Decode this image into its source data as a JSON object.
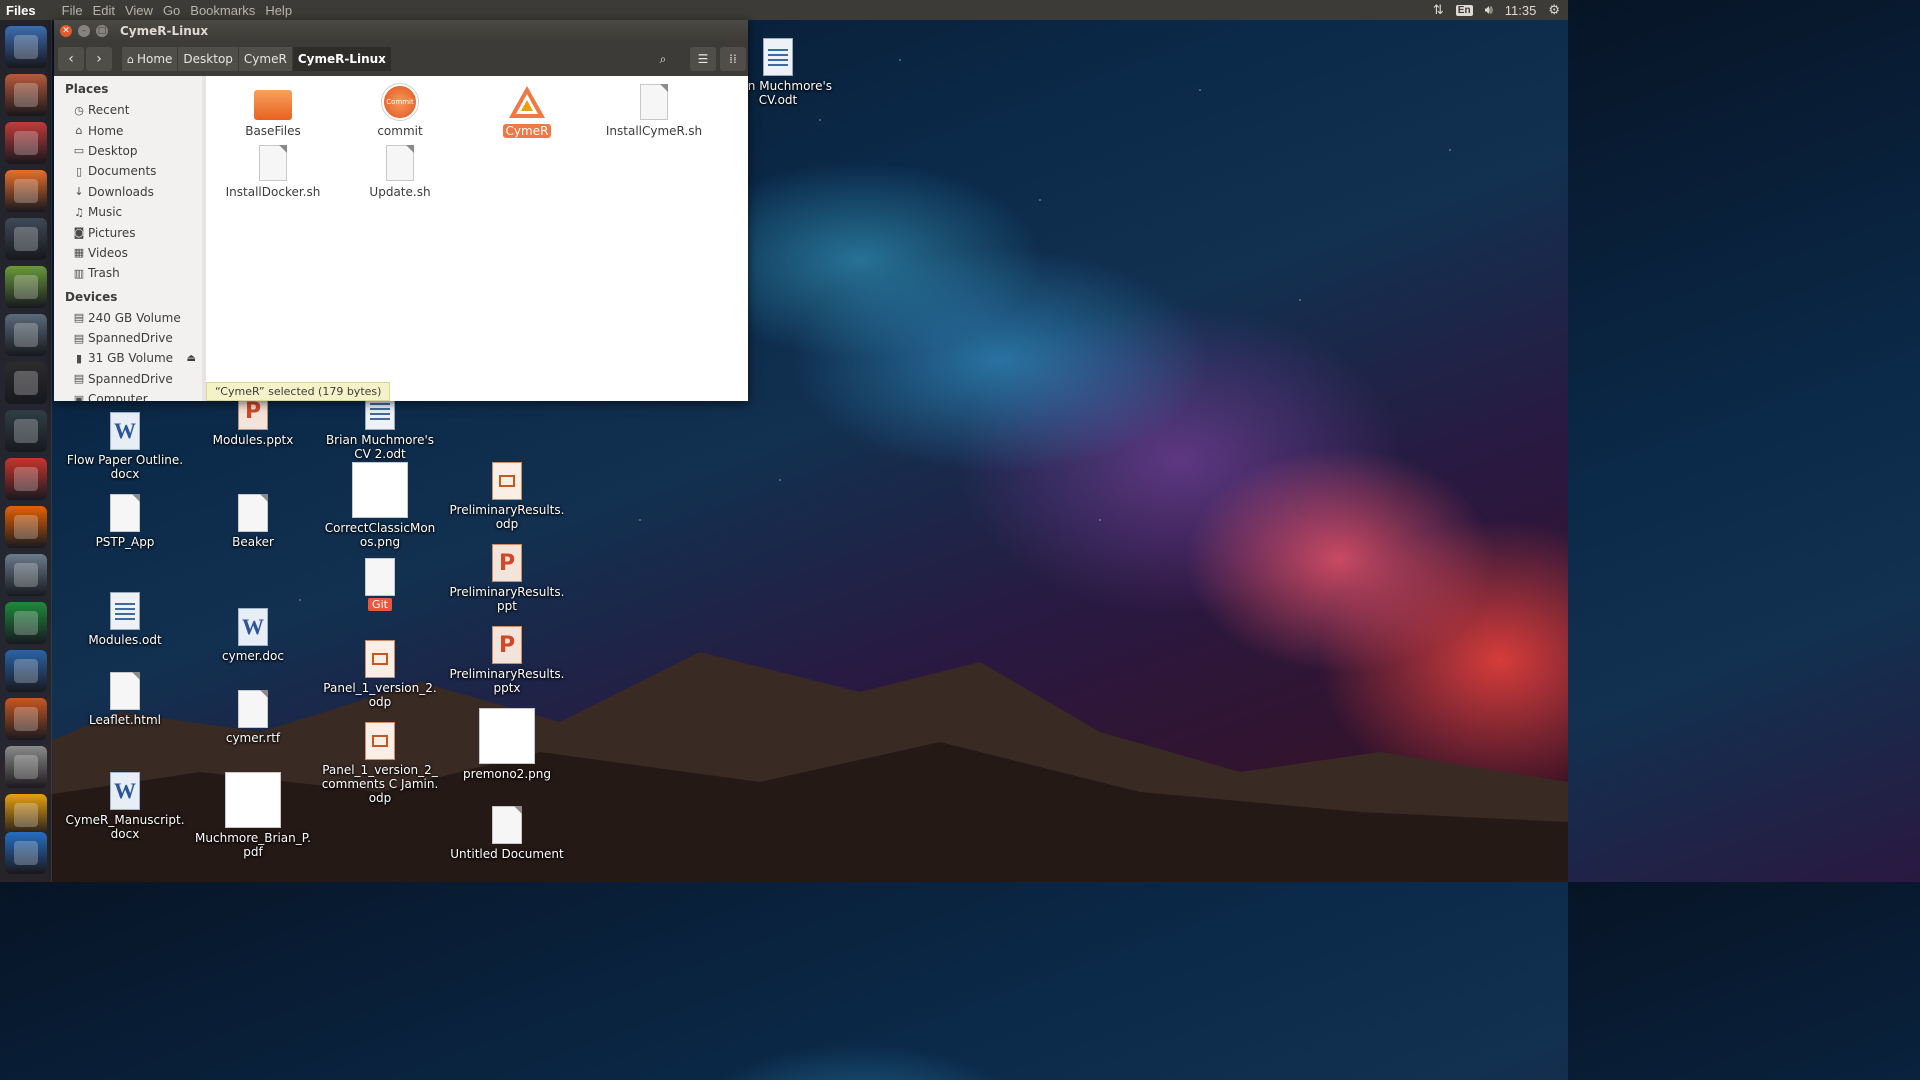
{
  "top_panel": {
    "app_name": "Files",
    "menu": [
      "File",
      "Edit",
      "View",
      "Go",
      "Bookmarks",
      "Help"
    ],
    "keyboard_layout": "En",
    "clock": "11:35"
  },
  "launcher": {
    "items": [
      {
        "name": "dash-icon",
        "color": "#3b6db0"
      },
      {
        "name": "files-icon",
        "color": "#b85a3a"
      },
      {
        "name": "system-settings-icon",
        "color": "#c23b3b"
      },
      {
        "name": "software-center-icon",
        "color": "#e8702a"
      },
      {
        "name": "game-icon",
        "color": "#3f4a57"
      },
      {
        "name": "disk-usage-icon",
        "color": "#6a9a3a"
      },
      {
        "name": "printer-icon",
        "color": "#5a6b7a"
      },
      {
        "name": "terminal-icon",
        "color": "#2c2c2c"
      },
      {
        "name": "system-monitor-icon",
        "color": "#2f3e46"
      },
      {
        "name": "pdf-reader-icon",
        "color": "#c8342c"
      },
      {
        "name": "firefox-icon",
        "color": "#e66000"
      },
      {
        "name": "image-viewer-icon",
        "color": "#6b7b8b"
      },
      {
        "name": "libreoffice-calc-icon",
        "color": "#1e8a3c"
      },
      {
        "name": "libreoffice-writer-icon",
        "color": "#2a63a8"
      },
      {
        "name": "libreoffice-impress-icon",
        "color": "#c8571f"
      },
      {
        "name": "text-editor-icon",
        "color": "#8a8a8a"
      },
      {
        "name": "cymer-app-icon",
        "color": "#e8a010"
      },
      {
        "name": "r-app-icon",
        "color": "#276dc3"
      }
    ]
  },
  "window": {
    "title": "CymeR-Linux",
    "breadcrumb": [
      "Home",
      "Desktop",
      "CymeR",
      "CymeR-Linux"
    ],
    "sidebar": {
      "places_header": "Places",
      "places": [
        {
          "label": "Recent",
          "icon": "clock-icon"
        },
        {
          "label": "Home",
          "icon": "home-icon"
        },
        {
          "label": "Desktop",
          "icon": "desktop-icon"
        },
        {
          "label": "Documents",
          "icon": "document-icon"
        },
        {
          "label": "Downloads",
          "icon": "download-icon"
        },
        {
          "label": "Music",
          "icon": "music-icon"
        },
        {
          "label": "Pictures",
          "icon": "camera-icon"
        },
        {
          "label": "Videos",
          "icon": "video-icon"
        },
        {
          "label": "Trash",
          "icon": "trash-icon"
        }
      ],
      "devices_header": "Devices",
      "devices": [
        {
          "label": "240 GB Volume",
          "icon": "drive-icon"
        },
        {
          "label": "SpannedDrive",
          "icon": "drive-icon"
        },
        {
          "label": "31 GB Volume",
          "icon": "usb-icon",
          "eject": true
        },
        {
          "label": "SpannedDrive",
          "icon": "drive-icon"
        },
        {
          "label": "Computer",
          "icon": "computer-icon"
        }
      ]
    },
    "files": [
      {
        "name": "BaseFiles",
        "kind": "folder"
      },
      {
        "name": "commit",
        "kind": "app-orange",
        "badge": "Commit"
      },
      {
        "name": "CymeR",
        "kind": "cymer",
        "selected": true
      },
      {
        "name": "InstallCymeR.sh",
        "kind": "script"
      },
      {
        "name": "InstallDocker.sh",
        "kind": "script"
      },
      {
        "name": "Update.sh",
        "kind": "script"
      }
    ],
    "status": "“CymeR” selected  (179 bytes)"
  },
  "desktop": {
    "icons": [
      {
        "label": "Brian Muchmore's\nCV.odt",
        "kind": "odt"
      },
      {
        "label": "Modules.pptx",
        "kind": "ppt"
      },
      {
        "label": "Brian Muchmore's\nCV 2.odt",
        "kind": "odt"
      },
      {
        "label": "Flow Paper Outline.\ndocx",
        "kind": "word"
      },
      {
        "label": "PSTP_App",
        "kind": "text"
      },
      {
        "label": "Beaker",
        "kind": "text"
      },
      {
        "label": "CorrectClassicMon\nos.png",
        "kind": "thumb"
      },
      {
        "label": "PreliminaryResults.\nodp",
        "kind": "odp"
      },
      {
        "label": "Git",
        "kind": "git"
      },
      {
        "label": "PreliminaryResults.\nppt",
        "kind": "ppt"
      },
      {
        "label": "Modules.odt",
        "kind": "odt"
      },
      {
        "label": "cymer.doc",
        "kind": "word"
      },
      {
        "label": "Panel_1_version_2.\nodp",
        "kind": "odp"
      },
      {
        "label": "PreliminaryResults.\npptx",
        "kind": "ppt"
      },
      {
        "label": "Leaflet.html",
        "kind": "text"
      },
      {
        "label": "cymer.rtf",
        "kind": "text"
      },
      {
        "label": "Panel_1_version_2_\ncomments C Jamin.\nodp",
        "kind": "odp"
      },
      {
        "label": "premono2.png",
        "kind": "thumb"
      },
      {
        "label": "CymeR_Manuscript.\ndocx",
        "kind": "word"
      },
      {
        "label": "Muchmore_Brian_P.\npdf",
        "kind": "thumb"
      },
      {
        "label": "Untitled Document",
        "kind": "text"
      }
    ]
  },
  "colors": {
    "accent": "#f07746",
    "panel": "#3c3b37",
    "status_bg": "#f5f2c8"
  }
}
